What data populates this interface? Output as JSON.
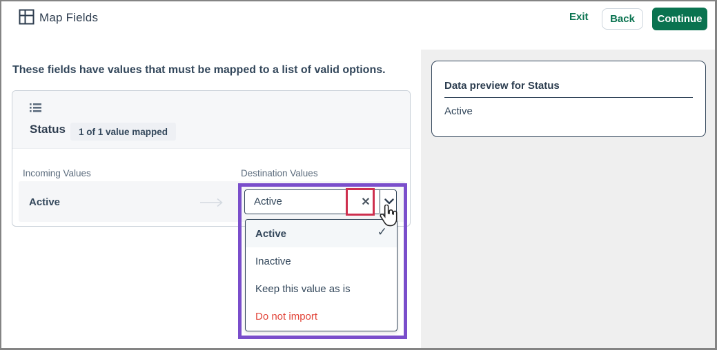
{
  "colors": {
    "brand_green": "#0a7350",
    "text_slate": "#33475b",
    "muted_label": "#5b6b7c",
    "panel_gray": "#efefef",
    "dark_border": "#32455a",
    "danger_red": "#e2453a",
    "annotation_red": "#ce2f4e",
    "annotation_purple": "#7a4ecb",
    "row_bg": "#f5f6f8",
    "card_header_bg": "#f6f7f9"
  },
  "topbar": {
    "title": "Map Fields",
    "exit_label": "Exit",
    "back_label": "Back",
    "continue_label": "Continue"
  },
  "main": {
    "heading": "These fields have values that must be mapped to a list of valid options.",
    "card": {
      "field_name": "Status",
      "badge": "1 of 1 value mapped",
      "incoming_header": "Incoming Values",
      "destination_header": "Destination Values",
      "incoming_value": "Active",
      "destination_value": "Active"
    },
    "dropdown": {
      "options": [
        {
          "label": "Active",
          "selected": true
        },
        {
          "label": "Inactive",
          "selected": false
        },
        {
          "label": "Keep this value as is",
          "selected": false
        },
        {
          "label": "Do not import",
          "selected": false,
          "style": "danger"
        }
      ]
    }
  },
  "preview": {
    "title": "Data preview for Status",
    "value": "Active"
  }
}
